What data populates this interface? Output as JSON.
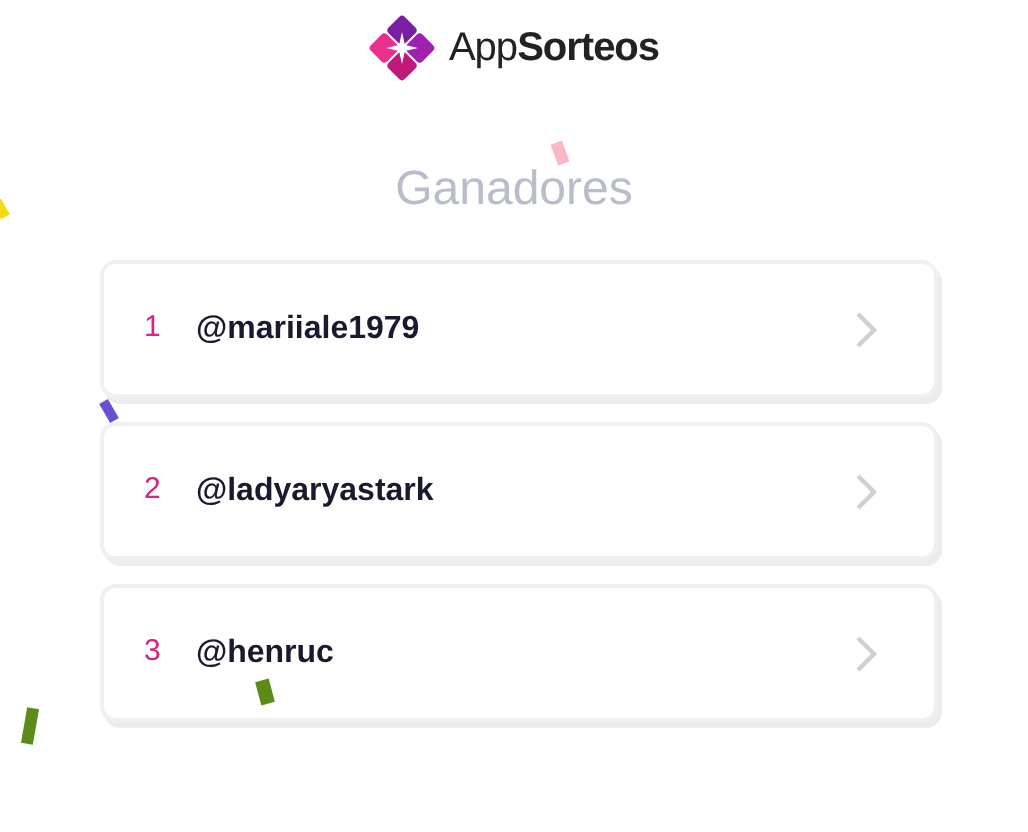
{
  "brand": {
    "name": "App**Sorteos**"
  },
  "title": "Ganadores",
  "winners": [
    {
      "rank": "1",
      "handle": "@mariiale1979"
    },
    {
      "rank": "2",
      "handle": "@ladyaryastark"
    },
    {
      "rank": "3",
      "handle": "@henruc"
    }
  ]
}
